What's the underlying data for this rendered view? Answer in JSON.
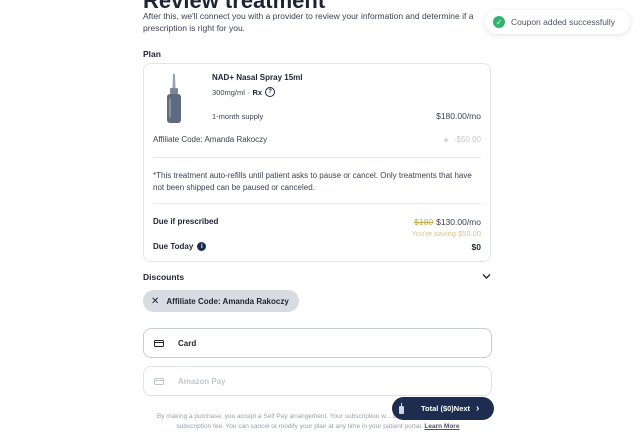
{
  "header": {
    "title": "Review treatment",
    "intro": "After this, we'll connect you with a provider to review your information and determine if a prescription is right for you."
  },
  "toast": {
    "text": "Coupon added successfully",
    "color": "#2fb26b"
  },
  "plan": {
    "section_label": "Plan",
    "product_name": "NAD+ Nasal Spray 15ml",
    "dosage": "300mg/ml ·",
    "rx_label": "Rx",
    "supply": "1-month supply",
    "price": "$180.00/mo",
    "affiliate_label": "Affiliate Code: Amanda Rakoczy",
    "affiliate_discount": "-$50.00",
    "note": "*This treatment auto-refills until patient asks to pause or cancel. Only treatments that have not been shipped can be paused or canceled.",
    "due_if_prescribed_label": "Due if prescribed",
    "original_price": "$180",
    "discounted_price": "$130.00/mo",
    "savings": "You're saving $50.00",
    "due_today_label": "Due Today",
    "due_today_value": "$0"
  },
  "discounts": {
    "section_label": "Discounts",
    "chip_label": "Affiliate Code: Amanda Rakoczy"
  },
  "payment": {
    "card_label": "Card",
    "amazon_pay_label": "Amazon Pay"
  },
  "footer": {
    "text": "By making a purchase, you accept a Self Pay arrangement. Your subscription w... credit card will be charged the subscription fee. You can cancel or modify your plan at any time in your patient portal.",
    "learn_more": "Learn More"
  },
  "cta": {
    "label": "Total ($0)Next",
    "chevron": "›"
  },
  "colors": {
    "accent": "#1e2d4f",
    "success": "#2fb26b",
    "savings": "#c9a84c"
  }
}
